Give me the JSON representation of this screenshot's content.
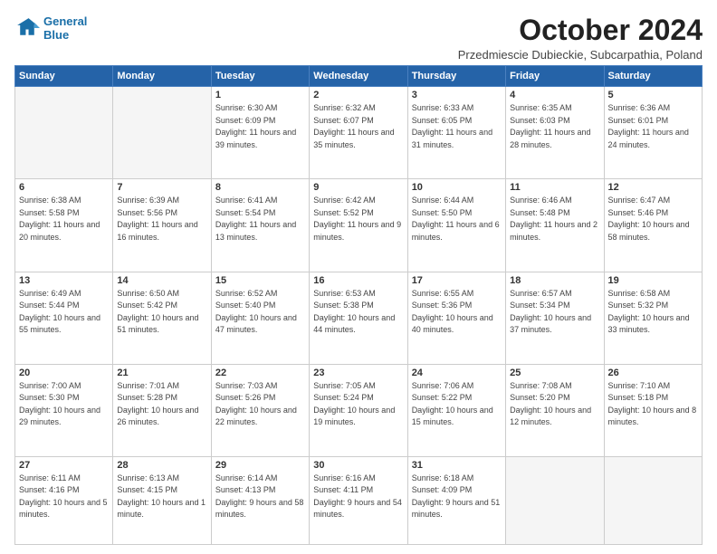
{
  "header": {
    "logo_line1": "General",
    "logo_line2": "Blue",
    "month_title": "October 2024",
    "subtitle": "Przedmiescie Dubieckie, Subcarpathia, Poland"
  },
  "weekdays": [
    "Sunday",
    "Monday",
    "Tuesday",
    "Wednesday",
    "Thursday",
    "Friday",
    "Saturday"
  ],
  "weeks": [
    [
      {
        "day": "",
        "empty": true
      },
      {
        "day": "",
        "empty": true
      },
      {
        "day": "1",
        "sunrise": "6:30 AM",
        "sunset": "6:09 PM",
        "daylight": "11 hours and 39 minutes."
      },
      {
        "day": "2",
        "sunrise": "6:32 AM",
        "sunset": "6:07 PM",
        "daylight": "11 hours and 35 minutes."
      },
      {
        "day": "3",
        "sunrise": "6:33 AM",
        "sunset": "6:05 PM",
        "daylight": "11 hours and 31 minutes."
      },
      {
        "day": "4",
        "sunrise": "6:35 AM",
        "sunset": "6:03 PM",
        "daylight": "11 hours and 28 minutes."
      },
      {
        "day": "5",
        "sunrise": "6:36 AM",
        "sunset": "6:01 PM",
        "daylight": "11 hours and 24 minutes."
      }
    ],
    [
      {
        "day": "6",
        "sunrise": "6:38 AM",
        "sunset": "5:58 PM",
        "daylight": "11 hours and 20 minutes."
      },
      {
        "day": "7",
        "sunrise": "6:39 AM",
        "sunset": "5:56 PM",
        "daylight": "11 hours and 16 minutes."
      },
      {
        "day": "8",
        "sunrise": "6:41 AM",
        "sunset": "5:54 PM",
        "daylight": "11 hours and 13 minutes."
      },
      {
        "day": "9",
        "sunrise": "6:42 AM",
        "sunset": "5:52 PM",
        "daylight": "11 hours and 9 minutes."
      },
      {
        "day": "10",
        "sunrise": "6:44 AM",
        "sunset": "5:50 PM",
        "daylight": "11 hours and 6 minutes."
      },
      {
        "day": "11",
        "sunrise": "6:46 AM",
        "sunset": "5:48 PM",
        "daylight": "11 hours and 2 minutes."
      },
      {
        "day": "12",
        "sunrise": "6:47 AM",
        "sunset": "5:46 PM",
        "daylight": "10 hours and 58 minutes."
      }
    ],
    [
      {
        "day": "13",
        "sunrise": "6:49 AM",
        "sunset": "5:44 PM",
        "daylight": "10 hours and 55 minutes."
      },
      {
        "day": "14",
        "sunrise": "6:50 AM",
        "sunset": "5:42 PM",
        "daylight": "10 hours and 51 minutes."
      },
      {
        "day": "15",
        "sunrise": "6:52 AM",
        "sunset": "5:40 PM",
        "daylight": "10 hours and 47 minutes."
      },
      {
        "day": "16",
        "sunrise": "6:53 AM",
        "sunset": "5:38 PM",
        "daylight": "10 hours and 44 minutes."
      },
      {
        "day": "17",
        "sunrise": "6:55 AM",
        "sunset": "5:36 PM",
        "daylight": "10 hours and 40 minutes."
      },
      {
        "day": "18",
        "sunrise": "6:57 AM",
        "sunset": "5:34 PM",
        "daylight": "10 hours and 37 minutes."
      },
      {
        "day": "19",
        "sunrise": "6:58 AM",
        "sunset": "5:32 PM",
        "daylight": "10 hours and 33 minutes."
      }
    ],
    [
      {
        "day": "20",
        "sunrise": "7:00 AM",
        "sunset": "5:30 PM",
        "daylight": "10 hours and 29 minutes."
      },
      {
        "day": "21",
        "sunrise": "7:01 AM",
        "sunset": "5:28 PM",
        "daylight": "10 hours and 26 minutes."
      },
      {
        "day": "22",
        "sunrise": "7:03 AM",
        "sunset": "5:26 PM",
        "daylight": "10 hours and 22 minutes."
      },
      {
        "day": "23",
        "sunrise": "7:05 AM",
        "sunset": "5:24 PM",
        "daylight": "10 hours and 19 minutes."
      },
      {
        "day": "24",
        "sunrise": "7:06 AM",
        "sunset": "5:22 PM",
        "daylight": "10 hours and 15 minutes."
      },
      {
        "day": "25",
        "sunrise": "7:08 AM",
        "sunset": "5:20 PM",
        "daylight": "10 hours and 12 minutes."
      },
      {
        "day": "26",
        "sunrise": "7:10 AM",
        "sunset": "5:18 PM",
        "daylight": "10 hours and 8 minutes."
      }
    ],
    [
      {
        "day": "27",
        "sunrise": "6:11 AM",
        "sunset": "4:16 PM",
        "daylight": "10 hours and 5 minutes."
      },
      {
        "day": "28",
        "sunrise": "6:13 AM",
        "sunset": "4:15 PM",
        "daylight": "10 hours and 1 minute."
      },
      {
        "day": "29",
        "sunrise": "6:14 AM",
        "sunset": "4:13 PM",
        "daylight": "9 hours and 58 minutes."
      },
      {
        "day": "30",
        "sunrise": "6:16 AM",
        "sunset": "4:11 PM",
        "daylight": "9 hours and 54 minutes."
      },
      {
        "day": "31",
        "sunrise": "6:18 AM",
        "sunset": "4:09 PM",
        "daylight": "9 hours and 51 minutes."
      },
      {
        "day": "",
        "empty": true
      },
      {
        "day": "",
        "empty": true
      }
    ]
  ],
  "labels": {
    "sunrise": "Sunrise:",
    "sunset": "Sunset:",
    "daylight": "Daylight:"
  }
}
